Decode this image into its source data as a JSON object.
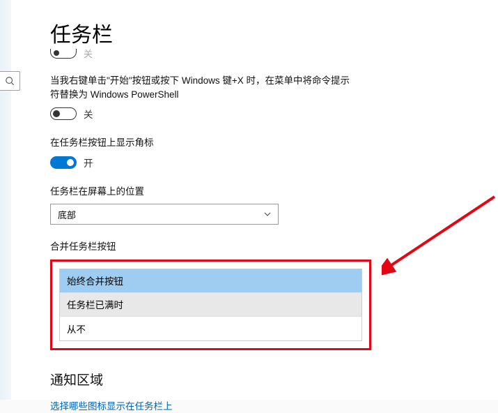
{
  "colors": {
    "accent": "#0078d4",
    "link": "#0066b4",
    "highlight": "#e30613",
    "selected_bg": "#9fcdf1"
  },
  "page": {
    "title": "任务栏"
  },
  "trunc": {
    "state": "关"
  },
  "settings": {
    "powershell": {
      "desc": "当我右键单击\"开始\"按钮或按下 Windows 键+X 时，在菜单中将命令提示符替换为 Windows PowerShell",
      "state": "关"
    },
    "badges": {
      "desc": "在任务栏按钮上显示角标",
      "state": "开"
    },
    "position": {
      "desc": "任务栏在屏幕上的位置",
      "value": "底部"
    },
    "combine": {
      "desc": "合并任务栏按钮",
      "options": [
        "始终合并按钮",
        "任务栏已满时",
        "从不"
      ],
      "selected": "始终合并按钮"
    }
  },
  "notification_section": {
    "title": "通知区域",
    "link": "选择哪些图标显示在任务栏上"
  }
}
